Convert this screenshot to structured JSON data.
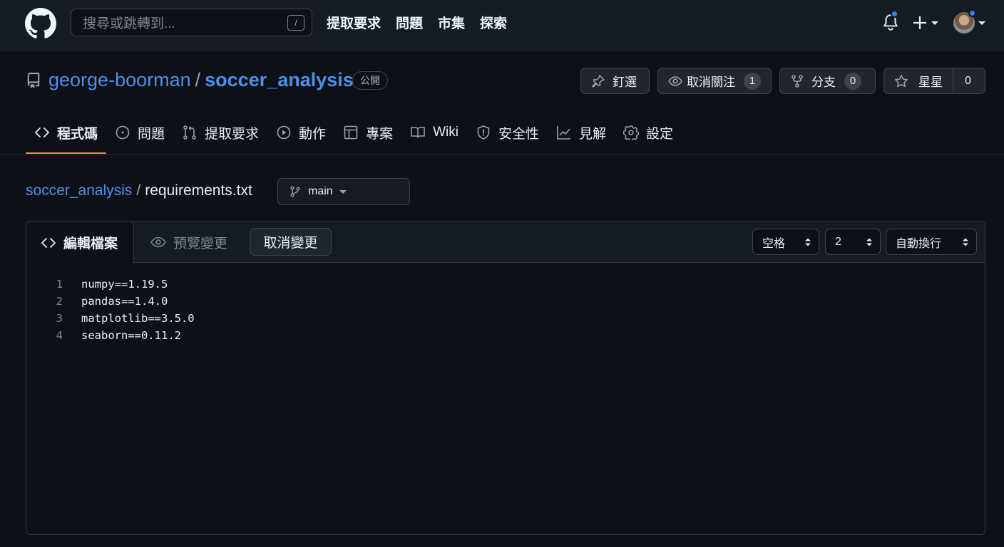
{
  "header": {
    "search_placeholder": "搜尋或跳轉到...",
    "search_shortcut": "/",
    "nav": [
      "提取要求",
      "問題",
      "市集",
      "探索"
    ]
  },
  "repo": {
    "owner": "george-boorman",
    "separator": "/",
    "name": "soccer_analysis",
    "visibility": "公開",
    "pin_label": "釘選",
    "watch_label": "取消關注",
    "watch_count": "1",
    "fork_label": "分支",
    "fork_count": "0",
    "star_label": "星星",
    "star_count": "0"
  },
  "tabs": [
    {
      "label": "程式碼",
      "icon": "code-icon",
      "active": true
    },
    {
      "label": "問題",
      "icon": "issue-icon"
    },
    {
      "label": "提取要求",
      "icon": "pull-request-icon"
    },
    {
      "label": "動作",
      "icon": "play-icon"
    },
    {
      "label": "專案",
      "icon": "table-icon"
    },
    {
      "label": "Wiki",
      "icon": "book-icon"
    },
    {
      "label": "安全性",
      "icon": "shield-icon"
    },
    {
      "label": "見解",
      "icon": "graph-icon"
    },
    {
      "label": "設定",
      "icon": "gear-icon"
    }
  ],
  "breadcrumb": {
    "repo": "soccer_analysis",
    "separator": "/",
    "file": "requirements.txt",
    "branch": "main"
  },
  "editor": {
    "edit_tab": "編輯檔案",
    "preview_tab": "預覽變更",
    "cancel_button": "取消變更",
    "indent_mode": "空格",
    "indent_size": "2",
    "wrap_mode": "自動換行",
    "lines": [
      {
        "num": "1",
        "text": "numpy==1.19.5"
      },
      {
        "num": "2",
        "text": "pandas==1.4.0"
      },
      {
        "num": "3",
        "text": "matplotlib==3.5.0"
      },
      {
        "num": "4",
        "text": "seaborn==0.11.2"
      }
    ]
  },
  "colors": {
    "background": "#0d1117",
    "header": "#161b22",
    "link": "#4f8fe6",
    "active_tab_underline": "#f78166",
    "notification_dot": "#2f81f7"
  }
}
